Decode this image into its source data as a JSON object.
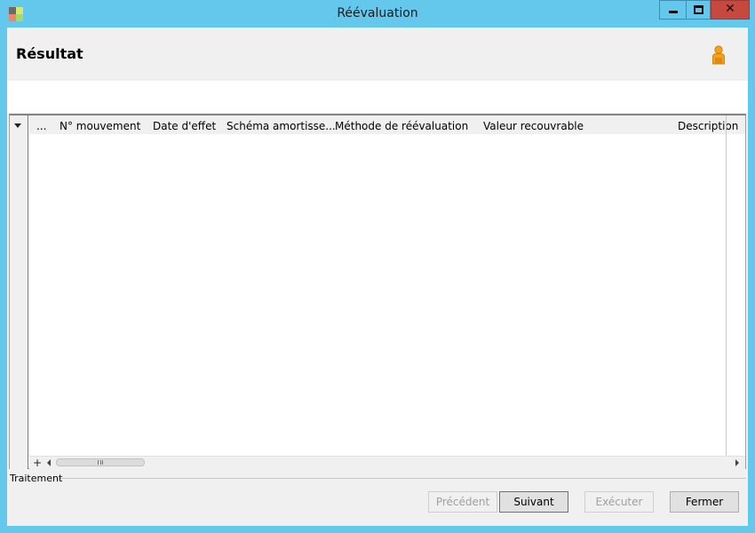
{
  "window": {
    "title": "Réévaluation",
    "min_glyph": "min-icon",
    "max_glyph": "max-icon",
    "close_glyph": "✕"
  },
  "header": {
    "title": "Résultat",
    "user_icon": "user-icon"
  },
  "grid": {
    "row_selector_col": "...",
    "columns": [
      "N° mouvement",
      "Date d'effet",
      "Schéma amortisse...",
      "Méthode de réévaluation",
      "Valeur recouvrable",
      "Description"
    ],
    "rows": [],
    "add_row_glyph": "+"
  },
  "section": {
    "label": "Traitement"
  },
  "buttons": {
    "previous": "Précédent",
    "next": "Suivant",
    "execute": "Exécuter",
    "close": "Fermer"
  },
  "colors": {
    "titlebar": "#63c8ec",
    "close_button": "#c7483f",
    "client_background": "#f0f0f0"
  }
}
